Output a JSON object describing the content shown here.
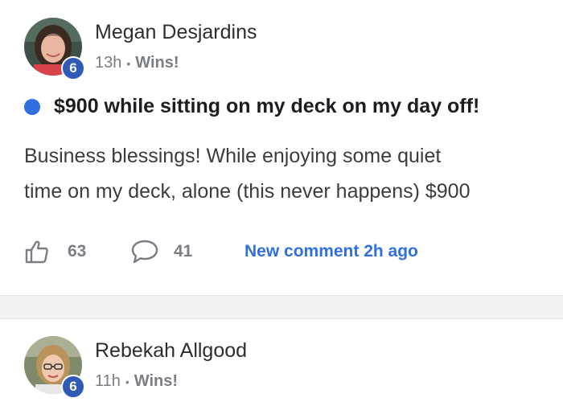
{
  "posts": [
    {
      "author": "Megan Desjardins",
      "level": "6",
      "time": "13h",
      "separator": "•",
      "category": "Wins!",
      "title": "$900 while sitting on my deck on my day off!",
      "body_lines": [
        "Business blessings! While enjoying some quiet",
        "time on my deck, alone (this never happens) $900"
      ],
      "likes": "63",
      "comments": "41",
      "new_comment": "New comment 2h ago"
    },
    {
      "author": "Rebekah Allgood",
      "level": "6",
      "time": "11h",
      "separator": "•",
      "category": "Wins!"
    }
  ],
  "colors": {
    "accent": "#2f6fe0",
    "badge": "#2f5bb7",
    "muted": "#7a7d83"
  },
  "icons": {
    "like": "thumbs-up-icon",
    "comment": "speech-bubble-icon",
    "unread": "unread-dot"
  }
}
